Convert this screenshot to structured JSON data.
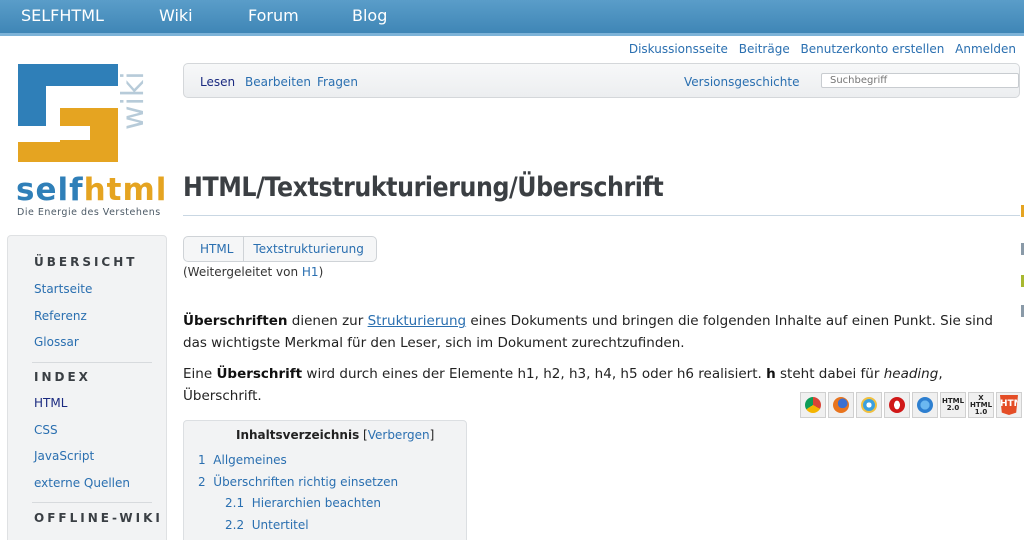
{
  "topnav": {
    "items": [
      {
        "label": "SELFHTML"
      },
      {
        "label": "Wiki"
      },
      {
        "label": "Forum"
      },
      {
        "label": "Blog"
      }
    ]
  },
  "personal": {
    "discussion": "Diskussionsseite",
    "contributions": "Beiträge",
    "create_account": "Benutzerkonto erstellen",
    "login": "Anmelden"
  },
  "logo": {
    "word_self": "self",
    "word_html": "html",
    "tagline": "Die Energie des Verstehens",
    "wiki_label": "wiki"
  },
  "tabs": {
    "read": "Lesen",
    "edit": "Bearbeiten",
    "ask": "Fragen",
    "history": "Versionsgeschichte",
    "search_placeholder": "Suchbegriff"
  },
  "sidebar": {
    "overview_heading": "ÜBERSICHT",
    "overview_items": [
      "Startseite",
      "Referenz",
      "Glossar"
    ],
    "index_heading": "INDEX",
    "index_items": [
      "HTML",
      "CSS",
      "JavaScript",
      "externe Quellen"
    ],
    "offline_heading": "OFFLINE-WIKI"
  },
  "content": {
    "title": "HTML/Textstrukturierung/Überschrift",
    "breadcrumb": [
      "HTML",
      "Textstrukturierung"
    ],
    "redirect_prefix": "(Weitergeleitet von ",
    "redirect_link": "H1",
    "redirect_suffix": ")",
    "p1_bold": "Überschriften",
    "p1_a": " dienen zur ",
    "p1_link": "Strukturierung",
    "p1_b": " eines Dokuments und bringen die folgenden Inhalte auf einen Punkt. Sie sind das wichtigste Merkmal für den Leser, sich im Dokument zurechtzufinden.",
    "p2_a": "Eine ",
    "p2_bold1": "Überschrift",
    "p2_b": " wird durch eines der Elemente h1, h2, h3, h4, h5 oder h6 realisiert. ",
    "p2_bold2": "h",
    "p2_c": " steht dabei für ",
    "p2_italic": "heading",
    "p2_d": ", Überschrift."
  },
  "browser_icons": {
    "html20": "HTML 2.0",
    "xhtml10": "X HTML 1.0",
    "html5": "HTML 5"
  },
  "toc": {
    "title": "Inhaltsverzeichnis",
    "toggle": "Verbergen",
    "items": [
      {
        "num": "1",
        "label": "Allgemeines"
      },
      {
        "num": "2",
        "label": "Überschriften richtig einsetzen"
      },
      {
        "num": "2.1",
        "label": "Hierarchien beachten"
      },
      {
        "num": "2.2",
        "label": "Untertitel"
      }
    ]
  }
}
